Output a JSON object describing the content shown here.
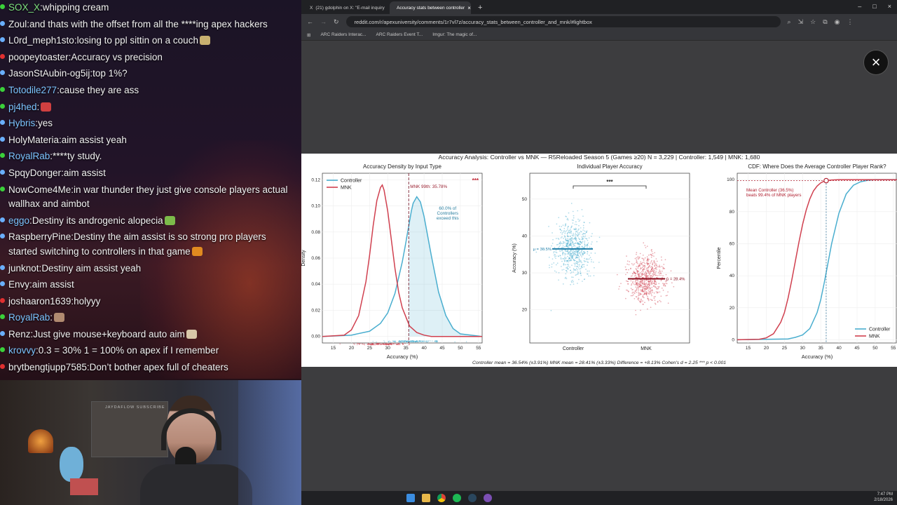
{
  "chat": {
    "messages": [
      {
        "user": "SOX_X",
        "text": "whipping cream",
        "color": "#7ee27e",
        "dot": "#3ad13a"
      },
      {
        "user": "Zoul",
        "text": "and thats with the offset from all the ****ing apex hackers",
        "color": "#f2f2f2",
        "dot": "#6ab0ff"
      },
      {
        "user": "L0rd_meph1sto",
        "text": "losing to ppl sittin on a couch",
        "color": "#f2f2f2",
        "dot": "#6ab0ff",
        "emoji": "#c8b070"
      },
      {
        "user": "poopeytoaster",
        "text": "Accuracy vs precision",
        "color": "#f2f2f2",
        "dot": "#e03030"
      },
      {
        "user": "JasonStAubin-og5ij",
        "text": "top 1%?",
        "color": "#f2f2f2",
        "dot": "#6ab0ff"
      },
      {
        "user": "Totodile277",
        "text": "cause they are ass",
        "color": "#7cc4ff",
        "dot": "#3ad13a"
      },
      {
        "user": "pj4hed",
        "text": "",
        "color": "#7cc4ff",
        "dot": "#3ad13a",
        "emoji": "#d04040"
      },
      {
        "user": "Hybris",
        "text": "yes",
        "color": "#7cc4ff",
        "dot": "#6ab0ff"
      },
      {
        "user": "HolyMateria",
        "text": "aim assist yeah",
        "color": "#f2f2f2",
        "dot": "#6ab0ff"
      },
      {
        "user": "RoyalRab",
        "text": "****ty study.",
        "color": "#7cc4ff",
        "dot": "#3ad13a"
      },
      {
        "user": "SpqyDonger",
        "text": "aim assist",
        "color": "#f2f2f2",
        "dot": "#6ab0ff"
      },
      {
        "user": "NowCome4Me",
        "text": "in war thunder they just give console players actual wallhax and aimbot",
        "color": "#f2f2f2",
        "dot": "#3ad13a"
      },
      {
        "user": "eggo",
        "text": "Destiny its androgenic alopecia",
        "color": "#7cc4ff",
        "dot": "#6ab0ff",
        "emoji": "#7cbb4a"
      },
      {
        "user": "RaspberryPine",
        "text": "Destiny the aim assist is so strong pro players started switching to controllers in that game",
        "color": "#f2f2f2",
        "dot": "#6ab0ff",
        "emoji": "#e08a20"
      },
      {
        "user": "junknot",
        "text": "Destiny    aim assist yeah",
        "color": "#f2f2f2",
        "dot": "#6ab0ff"
      },
      {
        "user": "Envy",
        "text": "aim assist",
        "color": "#f2f2f2",
        "dot": "#6ab0ff"
      },
      {
        "user": "joshaaron1639",
        "text": "holyyy",
        "color": "#f2f2f2",
        "dot": "#e03030"
      },
      {
        "user": "RoyalRab",
        "text": "",
        "color": "#7cc4ff",
        "dot": "#3ad13a",
        "emoji": "#b08a70"
      },
      {
        "user": "Renz",
        "text": "Just give mouse+keyboard auto aim",
        "color": "#f2f2f2",
        "dot": "#6ab0ff",
        "emoji": "#d8c8a8"
      },
      {
        "user": "krovvy",
        "text": "0.3 = 30% 1 = 100% on apex if I remember",
        "color": "#7cc4ff",
        "dot": "#3ad13a"
      },
      {
        "user": "brytbengtjupp7585",
        "text": "Don’t bother apex full of cheaters",
        "color": "#f2f2f2",
        "dot": "#e03030"
      }
    ]
  },
  "webcam": {
    "sign_text": "JAYDAFLOW SUBSCRIBE"
  },
  "browser": {
    "tabs": [
      {
        "label": "(21) gdolphin on X: \"E-mail inquiry",
        "active": false
      },
      {
        "label": "Accuracy stats between controller",
        "active": true
      }
    ],
    "url": "reddit.com/r/apexuniversity/comments/1r7vl7z/accuracy_stats_between_controller_and_mnk/#lightbox",
    "bookmarks": [
      "ARC Raiders Interac...",
      "ARC Raiders Event T...",
      "Imgur: The magic of..."
    ],
    "close_label": "×"
  },
  "figure": {
    "suptitle": "Accuracy Analysis: Controller vs MNK — R5Reloaded Season 5 (Games ≥20)    N = 3,229  |  Controller: 1,549  |  MNK: 1,680",
    "footer": "Controller mean = 36.54% (±3.91%)     MNK mean = 28.41% (±3.33%)     Difference = +8.13%     Cohen's d = 2.25     *** p < 0.001",
    "colors": {
      "controller": "#4aaecf",
      "mnk": "#d0404f"
    }
  },
  "chart_data": [
    {
      "type": "line",
      "title": "Accuracy Density by Input Type",
      "xlabel": "Accuracy (%)",
      "ylabel": "Density",
      "xlim": [
        12,
        56
      ],
      "ylim": [
        -0.005,
        0.125
      ],
      "xticks": [
        15,
        20,
        25,
        30,
        35,
        40,
        45,
        50,
        55
      ],
      "yticks": [
        0.0,
        0.02,
        0.04,
        0.06,
        0.08,
        0.1,
        0.12
      ],
      "legend": "top-left",
      "series": [
        {
          "name": "Controller",
          "x": [
            12,
            20,
            25,
            28,
            30,
            32,
            34,
            35,
            36,
            36.5,
            37,
            38,
            39,
            40,
            42,
            44,
            46,
            48,
            50,
            56
          ],
          "y": [
            0,
            0.001,
            0.004,
            0.01,
            0.018,
            0.033,
            0.057,
            0.072,
            0.088,
            0.096,
            0.102,
            0.107,
            0.103,
            0.092,
            0.062,
            0.034,
            0.016,
            0.006,
            0.002,
            0
          ]
        },
        {
          "name": "MNK",
          "x": [
            12,
            18,
            20,
            22,
            24,
            25,
            26,
            27,
            28,
            28.5,
            29,
            30,
            31,
            32,
            33,
            34,
            36,
            38,
            40,
            42,
            46,
            56
          ],
          "y": [
            0,
            0.001,
            0.005,
            0.016,
            0.042,
            0.062,
            0.085,
            0.104,
            0.114,
            0.116,
            0.112,
            0.096,
            0.074,
            0.052,
            0.034,
            0.022,
            0.008,
            0.003,
            0.001,
            0,
            0,
            0
          ]
        }
      ],
      "annotations": [
        "MNK 99th: 35.78%",
        "60.0% of Controllers exceed this",
        "***"
      ],
      "vline_x": 35.78
    },
    {
      "type": "scatter",
      "title": "Individual Player Accuracy",
      "ylabel": "Accuracy (%)",
      "categories": [
        "Controller",
        "MNK"
      ],
      "ylim": [
        11,
        57
      ],
      "yticks": [
        20,
        30,
        40,
        50
      ],
      "series": [
        {
          "name": "Controller",
          "mean": 36.5,
          "sd": 3.91,
          "n": 1549
        },
        {
          "name": "MNK",
          "mean": 28.4,
          "sd": 3.33,
          "n": 1680
        }
      ],
      "annotations": [
        "μ = 36.5%",
        "μ = 28.4%",
        "***"
      ]
    },
    {
      "type": "line",
      "title": "CDF: Where Does the Average Controller Player Rank?",
      "xlabel": "Accuracy (%)",
      "ylabel": "Percentile",
      "xlim": [
        12,
        56
      ],
      "ylim": [
        -2,
        104
      ],
      "xticks": [
        15,
        20,
        25,
        30,
        35,
        40,
        45,
        50,
        55
      ],
      "yticks": [
        0,
        20,
        40,
        60,
        80,
        100
      ],
      "legend": "bottom-right",
      "series": [
        {
          "name": "Controller",
          "x": [
            12,
            26,
            28,
            30,
            32,
            34,
            35,
            36,
            36.5,
            37,
            38,
            40,
            42,
            44,
            46,
            48,
            50,
            56
          ],
          "y": [
            0,
            0.5,
            1.5,
            3,
            7,
            17,
            25,
            36,
            42,
            48,
            60,
            79,
            91,
            96.5,
            98.7,
            99.6,
            100,
            100
          ]
        },
        {
          "name": "MNK",
          "x": [
            12,
            18,
            20,
            22,
            24,
            25,
            26,
            27,
            28,
            29,
            30,
            31,
            32,
            33,
            34,
            35,
            36,
            36.5,
            38,
            40,
            56
          ],
          "y": [
            0,
            0.3,
            1.2,
            3.8,
            11,
            17,
            26,
            37,
            49,
            61,
            72,
            81,
            88,
            93,
            96,
            98,
            99.1,
            99.4,
            99.8,
            100,
            100
          ]
        }
      ],
      "annotations": [
        "Mean Controller (36.5%) beats 99.4% of MNK players"
      ],
      "marker": {
        "x": 36.5,
        "y": 99.4
      }
    }
  ],
  "taskbar": {
    "time": "7:47 PM",
    "date": "2/18/2026"
  }
}
